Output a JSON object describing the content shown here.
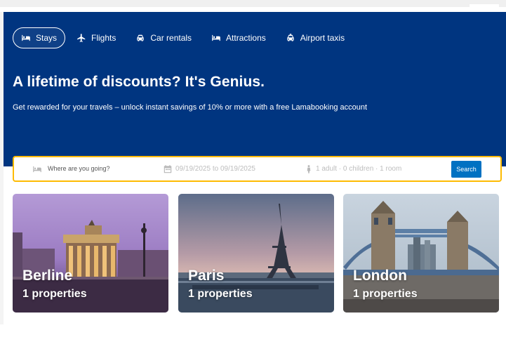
{
  "nav": {
    "items": [
      {
        "label": "Stays",
        "icon": "bed-icon",
        "active": true
      },
      {
        "label": "Flights",
        "icon": "plane-icon",
        "active": false
      },
      {
        "label": "Car rentals",
        "icon": "car-icon",
        "active": false
      },
      {
        "label": "Attractions",
        "icon": "bed-icon",
        "active": false
      },
      {
        "label": "Airport taxis",
        "icon": "taxi-icon",
        "active": false
      }
    ]
  },
  "hero": {
    "title": "A lifetime of discounts? It's Genius.",
    "subtitle": "Get rewarded for your travels – unlock instant savings of 10% or more with a free Lamabooking account"
  },
  "search": {
    "destination_placeholder": "Where are you going?",
    "dates": "09/19/2025 to 09/19/2025",
    "guests": "1 adult · 0 children · 1 room",
    "button_label": "Search"
  },
  "destinations": [
    {
      "city": "Berline",
      "properties": "1 properties"
    },
    {
      "city": "Paris",
      "properties": "1 properties"
    },
    {
      "city": "London",
      "properties": "1 properties"
    }
  ],
  "colors": {
    "hero_bg": "#003580",
    "search_border": "#febb02",
    "search_button": "#0071c2"
  }
}
